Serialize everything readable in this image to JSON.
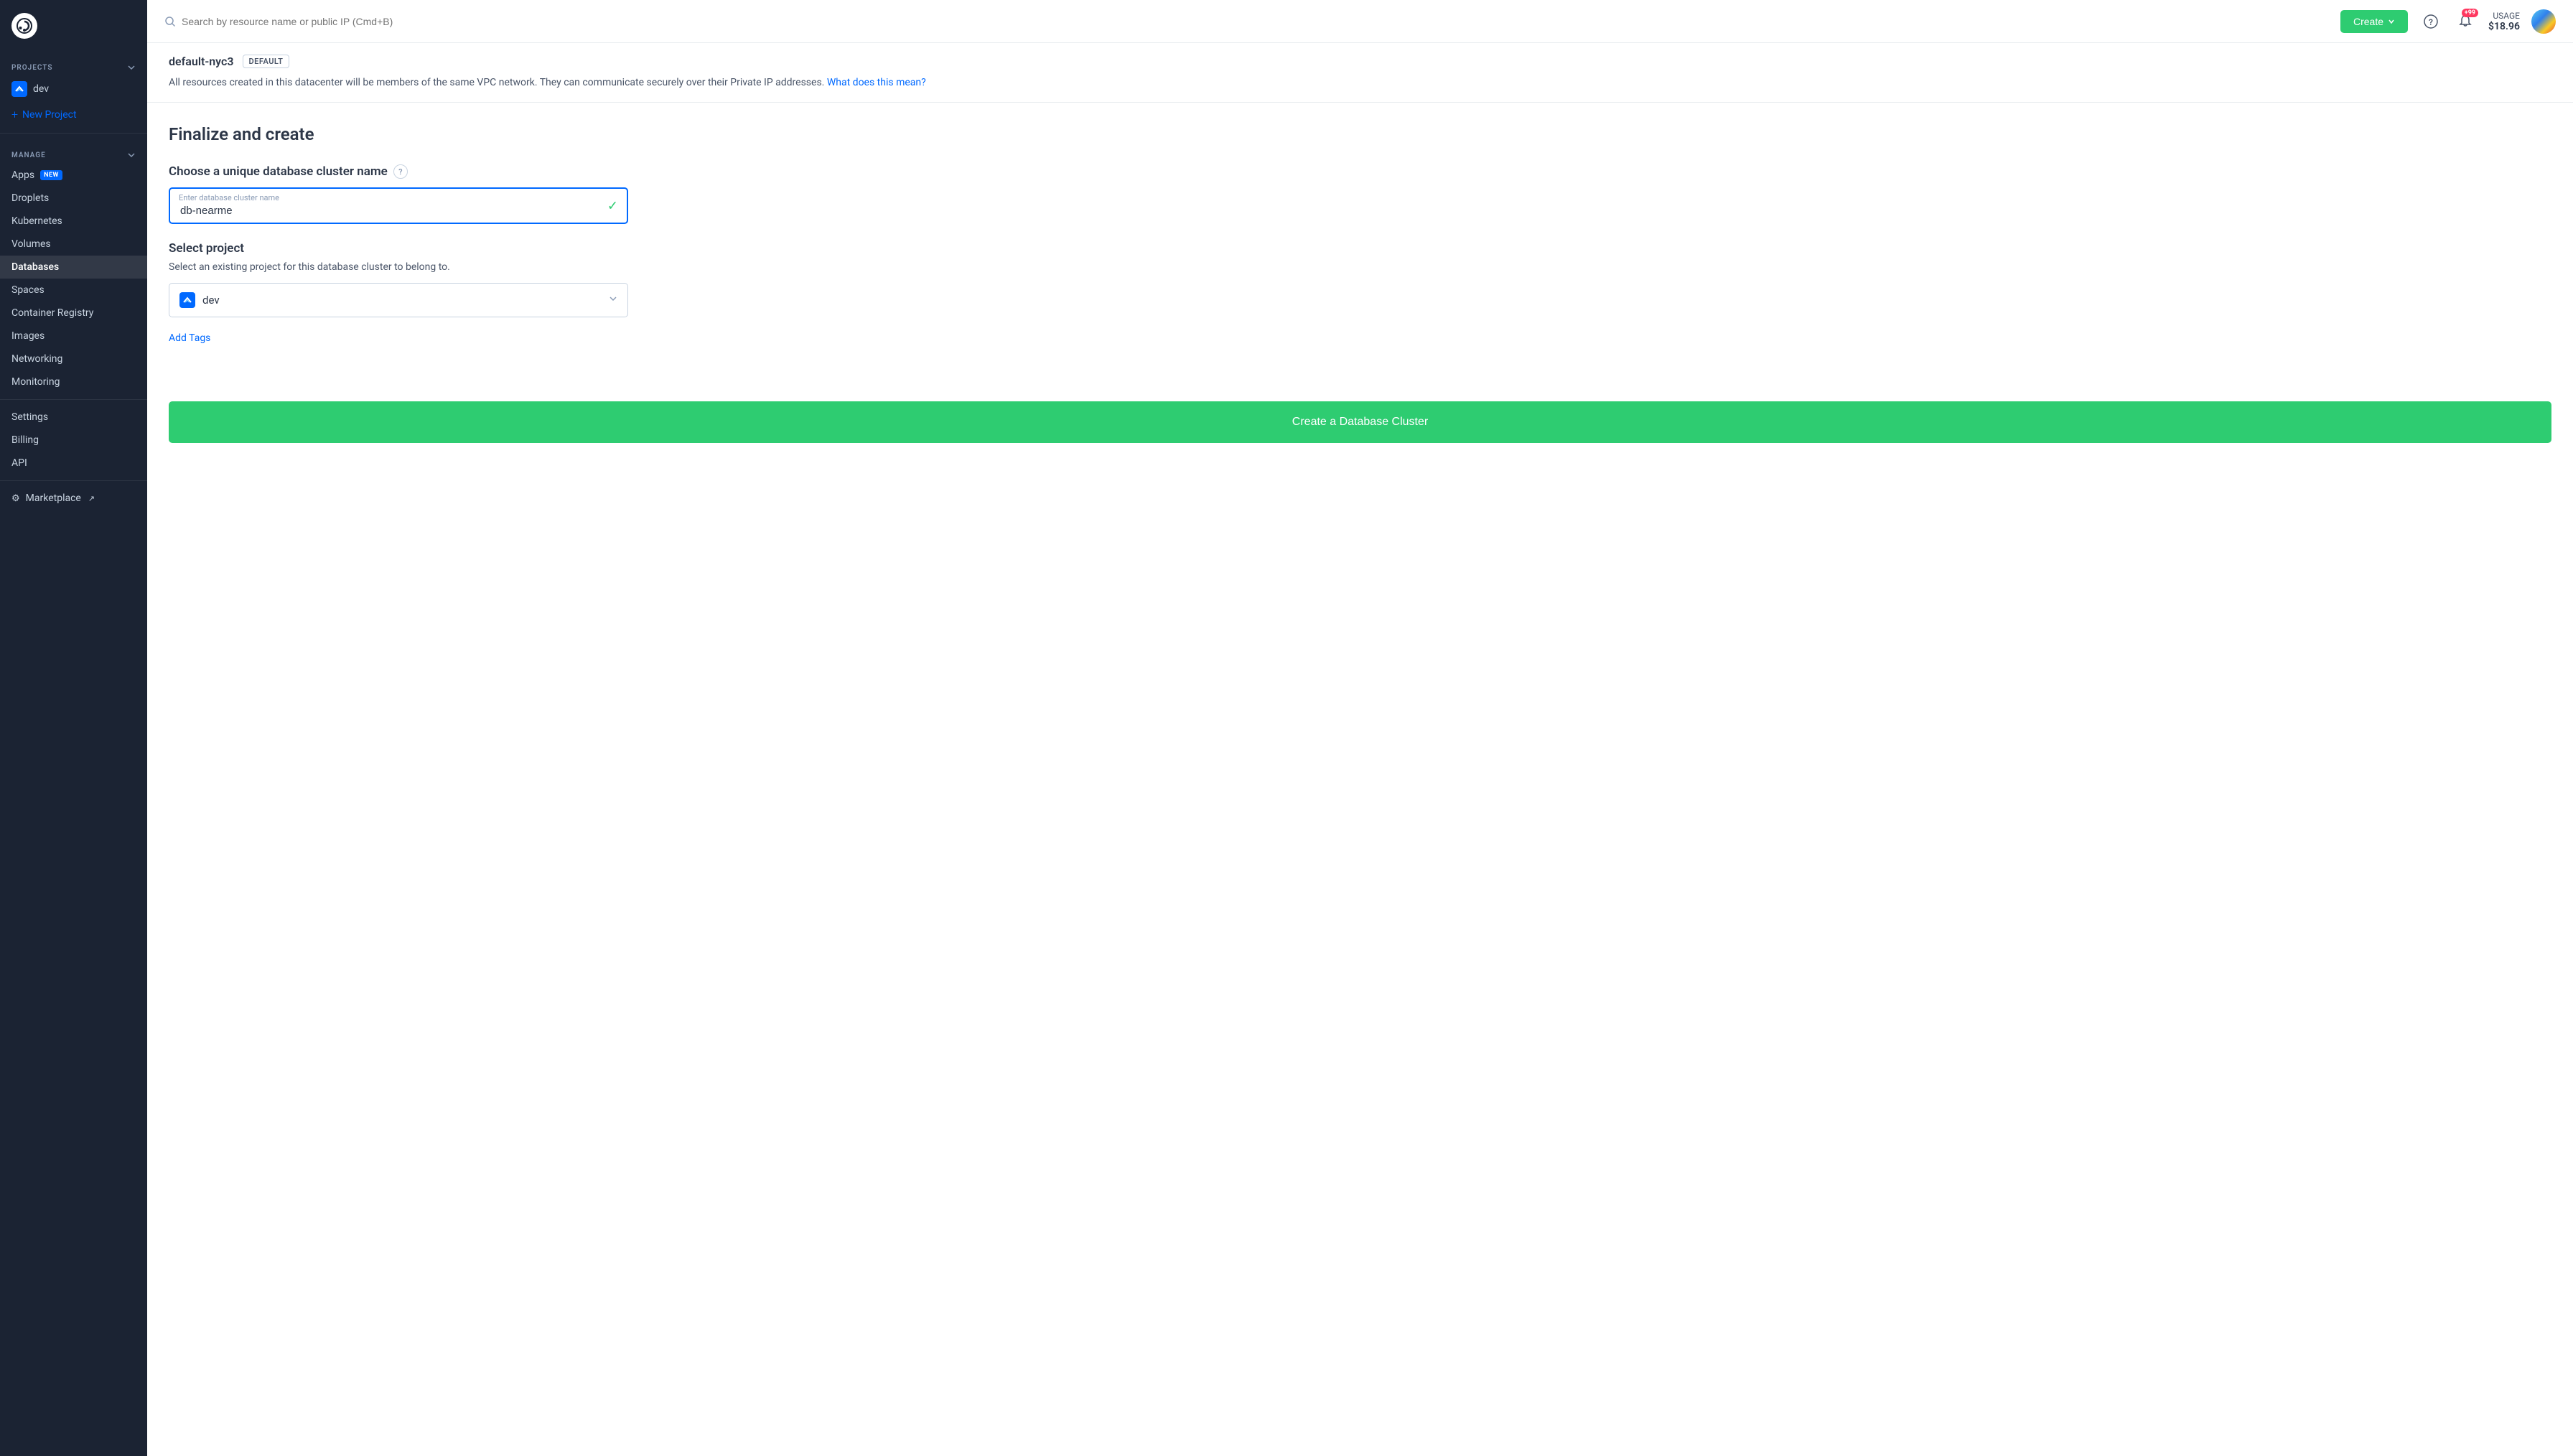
{
  "sidebar": {
    "logo_text": "D",
    "projects_label": "PROJECTS",
    "project_name": "dev",
    "new_project_label": "New Project",
    "manage_label": "MANAGE",
    "nav_items": [
      {
        "id": "apps",
        "label": "Apps",
        "badge": "NEW"
      },
      {
        "id": "droplets",
        "label": "Droplets"
      },
      {
        "id": "kubernetes",
        "label": "Kubernetes"
      },
      {
        "id": "volumes",
        "label": "Volumes"
      },
      {
        "id": "databases",
        "label": "Databases",
        "active": true
      },
      {
        "id": "spaces",
        "label": "Spaces"
      },
      {
        "id": "container-registry",
        "label": "Container Registry"
      },
      {
        "id": "images",
        "label": "Images"
      },
      {
        "id": "networking",
        "label": "Networking"
      },
      {
        "id": "monitoring",
        "label": "Monitoring"
      }
    ],
    "bottom_items": [
      {
        "id": "settings",
        "label": "Settings"
      },
      {
        "id": "billing",
        "label": "Billing"
      },
      {
        "id": "api",
        "label": "API"
      }
    ],
    "marketplace_label": "Marketplace"
  },
  "topbar": {
    "search_placeholder": "Search by resource name or public IP (Cmd+B)",
    "create_label": "Create",
    "notification_count": "+99",
    "usage_label": "USAGE",
    "usage_value": "$18.96"
  },
  "datacenter": {
    "name": "default-nyc3",
    "badge": "DEFAULT",
    "description": "All resources created in this datacenter will be members of the same VPC network. They can communicate securely over their Private IP addresses.",
    "link_text": "What does this mean?"
  },
  "form": {
    "section_title": "Finalize and create",
    "cluster_name_label": "Choose a unique database cluster name",
    "cluster_name_placeholder": "Enter database cluster name",
    "cluster_name_value": "db-nearme",
    "select_project_title": "Select project",
    "select_project_desc": "Select an existing project for this database cluster to belong to.",
    "selected_project": "dev",
    "add_tags_label": "Add Tags",
    "create_button_label": "Create a Database Cluster"
  }
}
